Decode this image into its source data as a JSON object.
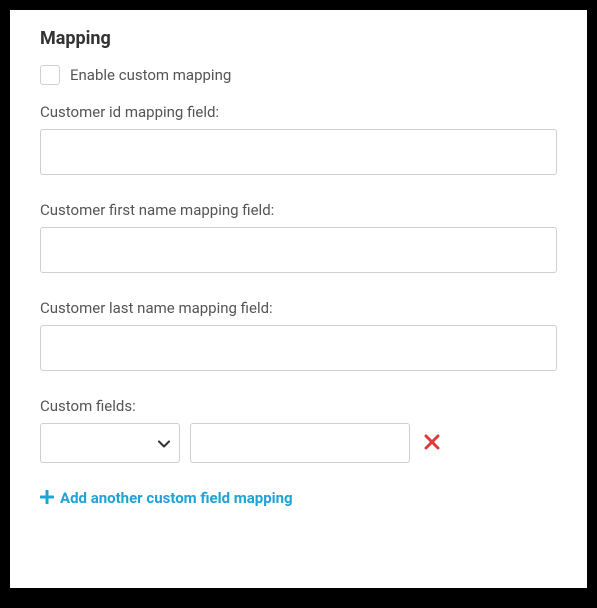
{
  "section": {
    "title": "Mapping"
  },
  "enable_custom": {
    "label": "Enable custom mapping",
    "checked": false
  },
  "fields": {
    "customer_id": {
      "label": "Customer id mapping field:",
      "value": ""
    },
    "first_name": {
      "label": "Customer first name mapping field:",
      "value": ""
    },
    "last_name": {
      "label": "Customer last name mapping field:",
      "value": ""
    }
  },
  "custom_fields": {
    "label": "Custom fields:",
    "rows": [
      {
        "selected": "",
        "value": ""
      }
    ]
  },
  "add_link": {
    "label": "Add another custom field mapping"
  }
}
